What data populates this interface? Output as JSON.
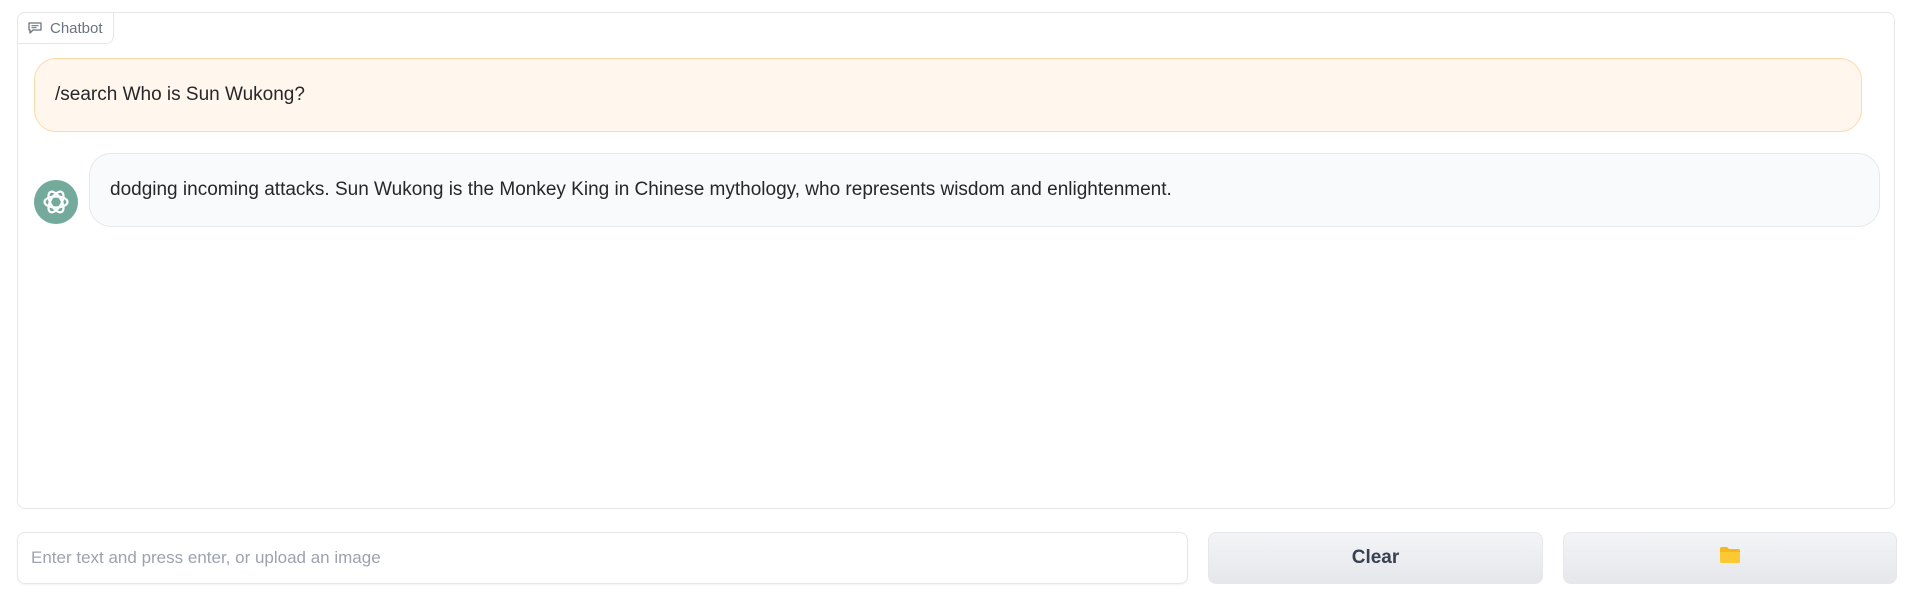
{
  "panel": {
    "label": "Chatbot",
    "label_icon": "chat-bubble-icon"
  },
  "messages": [
    {
      "role": "user",
      "text": "/search Who is Sun Wukong?"
    },
    {
      "role": "assistant",
      "avatar_icon": "openai-logo-icon",
      "text": "dodging incoming attacks. Sun Wukong is the Monkey King in Chinese mythology, who represents wisdom and enlightenment."
    }
  ],
  "input": {
    "value": "",
    "placeholder": "Enter text and press enter, or upload an image"
  },
  "buttons": {
    "clear_label": "Clear",
    "upload_icon": "folder-icon"
  },
  "colors": {
    "user_bubble": "#fff7ed",
    "user_border": "#fcd9a8",
    "bot_bubble": "#f9fafb",
    "avatar": "#74aa9c",
    "folder": "#f5b719"
  }
}
